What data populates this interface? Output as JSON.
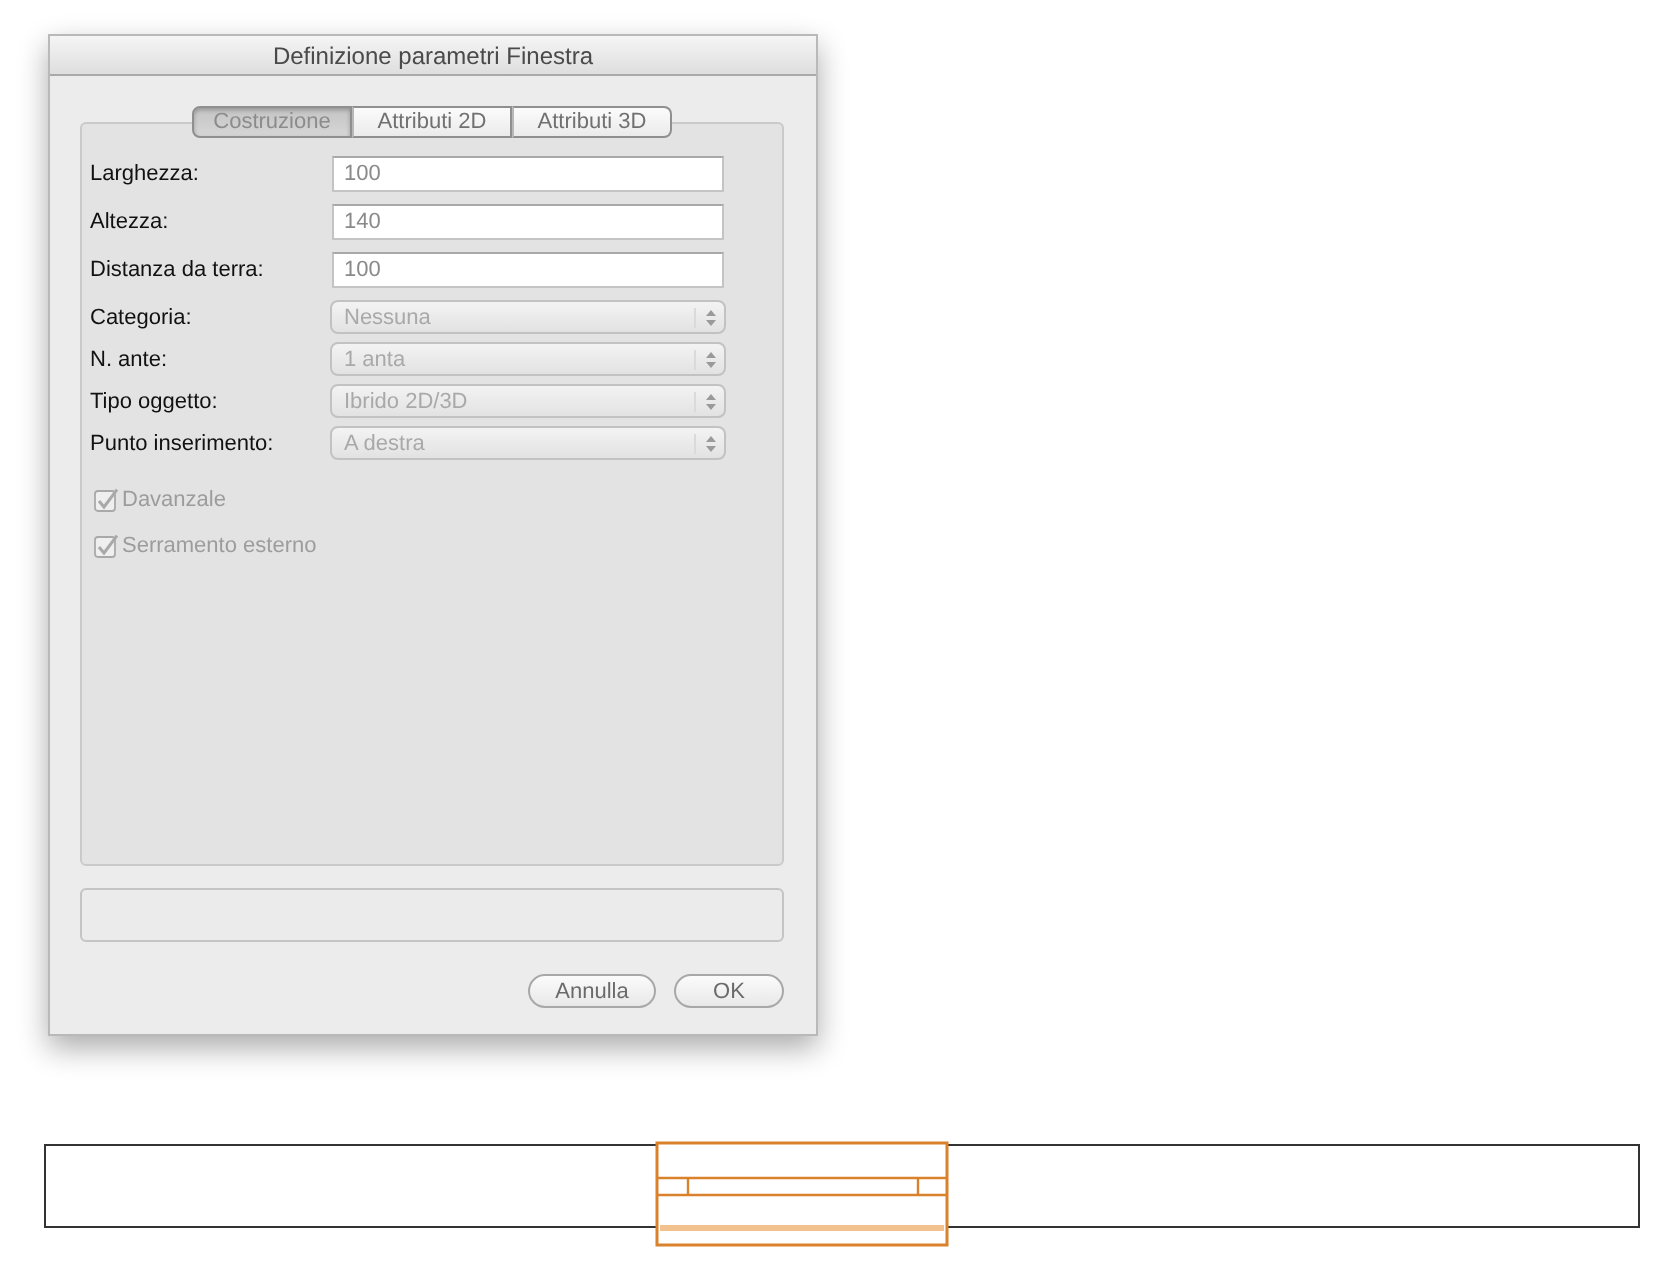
{
  "window": {
    "title": "Definizione parametri Finestra"
  },
  "tabs": [
    {
      "label": "Costruzione",
      "selected": true
    },
    {
      "label": "Attributi 2D",
      "selected": false
    },
    {
      "label": "Attributi 3D",
      "selected": false
    }
  ],
  "fields": [
    {
      "kind": "text",
      "label": "Larghezza:",
      "value": "100",
      "disabled": false
    },
    {
      "kind": "text",
      "label": "Altezza:",
      "value": "140",
      "disabled": false
    },
    {
      "kind": "text",
      "label": "Distanza da terra:",
      "value": "100",
      "disabled": false
    },
    {
      "kind": "popup",
      "label": "Categoria:",
      "value": "Nessuna",
      "disabled": true
    },
    {
      "kind": "popup",
      "label": "N. ante:",
      "value": "1 anta",
      "disabled": true
    },
    {
      "kind": "popup",
      "label": "Tipo oggetto:",
      "value": "Ibrido 2D/3D",
      "disabled": true
    },
    {
      "kind": "popup",
      "label": "Punto inserimento:",
      "value": "A destra",
      "disabled": true
    }
  ],
  "checkboxes": [
    {
      "label": "Davanzale",
      "checked": true,
      "disabled": true
    },
    {
      "label": "Serramento esterno",
      "checked": true,
      "disabled": true
    }
  ],
  "buttons": [
    {
      "label": "Annulla"
    },
    {
      "label": "OK"
    }
  ]
}
